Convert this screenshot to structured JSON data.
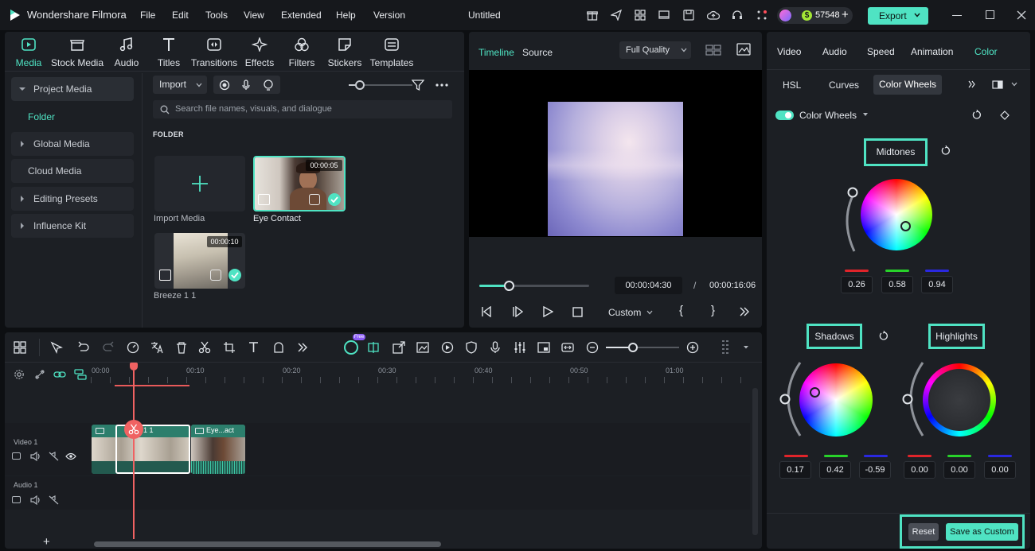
{
  "app": {
    "name": "Wondershare Filmora",
    "project_title": "Untitled",
    "credits": "57548",
    "export_label": "Export"
  },
  "menu": [
    "File",
    "Edit",
    "Tools",
    "View",
    "Extended",
    "Help",
    "Version"
  ],
  "media_tabs": [
    "Media",
    "Stock Media",
    "Audio",
    "Titles",
    "Transitions",
    "Effects",
    "Filters",
    "Stickers",
    "Templates"
  ],
  "sidebar": {
    "items": [
      {
        "label": "Project Media"
      },
      {
        "label": "Folder"
      },
      {
        "label": "Global Media"
      },
      {
        "label": "Cloud Media"
      },
      {
        "label": "Editing Presets"
      },
      {
        "label": "Influence Kit"
      }
    ]
  },
  "library": {
    "import_label": "Import",
    "search_placeholder": "Search file names, visuals, and dialogue",
    "folder_heading": "FOLDER",
    "items": [
      {
        "label": "Import Media"
      },
      {
        "label": "Eye Contact",
        "duration": "00:00:05"
      },
      {
        "label": "Breeze 1 1",
        "duration": "00:00:10"
      }
    ]
  },
  "player": {
    "tabs": [
      "Timeline",
      "Source"
    ],
    "quality": "Full Quality",
    "current_time": "00:00:04:30",
    "separator": "/",
    "total_time": "00:00:16:06",
    "ratio": "Custom",
    "progress": 0.27
  },
  "right_panel": {
    "tabs": [
      "Video",
      "Audio",
      "Speed",
      "Animation",
      "Color"
    ],
    "sub_tabs": [
      "HSL",
      "Curves",
      "Color Wheels"
    ],
    "toggle_label": "Color Wheels",
    "midtones": {
      "label": "Midtones",
      "values": [
        "0.26",
        "0.58",
        "0.94"
      ]
    },
    "shadows": {
      "label": "Shadows",
      "values": [
        "0.17",
        "0.42",
        "-0.59"
      ]
    },
    "highlights": {
      "label": "Highlights",
      "values": [
        "0.00",
        "0.00",
        "0.00"
      ]
    },
    "reset_label": "Reset",
    "save_label": "Save as Custom",
    "accent": "#4fe3c3"
  },
  "timeline": {
    "ruler": [
      "00:00",
      "00:10",
      "00:20",
      "00:30",
      "00:40",
      "00:50",
      "01:00"
    ],
    "tracks": [
      {
        "label": "Video 1"
      },
      {
        "label": "Audio 1"
      }
    ],
    "clips": [
      {
        "label": "eze 1 1"
      },
      {
        "label": "Eye...act"
      }
    ],
    "free_badge": "Free"
  }
}
